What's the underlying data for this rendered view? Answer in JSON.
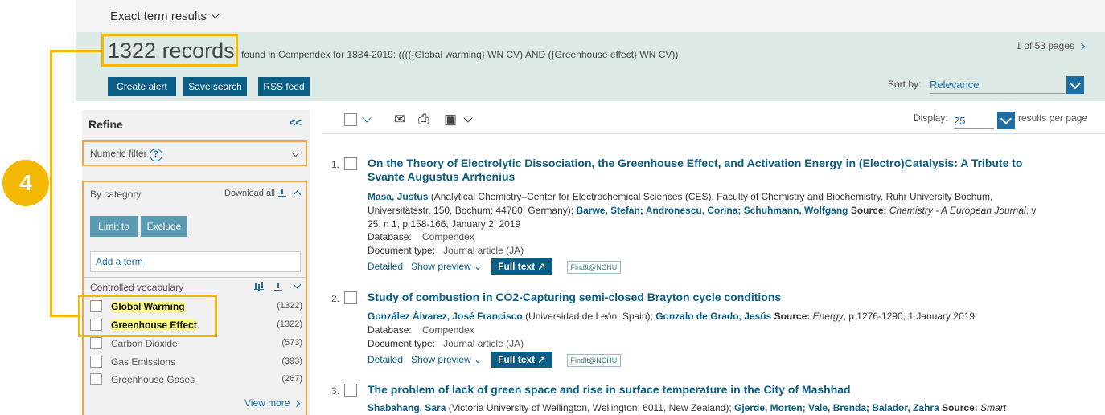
{
  "header": {
    "exact_term": "Exact term results",
    "records": "1322 records",
    "found_text": "found in Compendex for 1884-2019: (((({Global warming} WN CV) AND ({Greenhouse effect} WN CV))",
    "pages": "1 of 53 pages",
    "buttons": [
      "Create alert",
      "Save search",
      "RSS feed"
    ],
    "sort_label": "Sort by:",
    "sort_value": "Relevance"
  },
  "sidebar": {
    "refine": "Refine",
    "collapse": "<<",
    "numeric_filter": "Numeric filter",
    "help": "?",
    "by_category": "By category",
    "download_all": "Download all",
    "limit_to": "Limit to",
    "exclude": "Exclude",
    "add_term_placeholder": "Add a term",
    "controlled_vocab": "Controlled vocabulary",
    "items": [
      {
        "name": "Global Warming",
        "count": "(1322)"
      },
      {
        "name": "Greenhouse Effect",
        "count": "(1322)"
      },
      {
        "name": "Carbon Dioxide",
        "count": "(573)"
      },
      {
        "name": "Gas Emissions",
        "count": "(393)"
      },
      {
        "name": "Greenhouse Gases",
        "count": "(267)"
      }
    ],
    "view_more": "View more"
  },
  "annotation": {
    "step": "4",
    "color": "#f5b800"
  },
  "toolbar": {
    "display_label": "Display:",
    "display_value": "25",
    "per_page": "results per page"
  },
  "results": [
    {
      "num": "1.",
      "title": "On the Theory of Electrolytic Dissociation, the Greenhouse Effect, and Activation Energy in (Electro)Catalysis: A Tribute to Svante Augustus Arrhenius",
      "a1": "Masa, Justus",
      "aff1": " (Analytical Chemistry–Center for Electrochemical Sciences (CES), Faculty of Chemistry and Biochemistry, Ruhr University Bochum, Universitätsstr. 150, Bochum; 44780, Germany); ",
      "a2": "Barwe, Stefan; Andronescu, Corina; Schuhmann, Wolfgang",
      "source_label": " Source: ",
      "source": "Chemistry - A European Journal",
      "source_rest": ", v 25, n 1, p 158-166, January 2, 2019",
      "database": "Compendex",
      "doctype": "Journal article (JA)"
    },
    {
      "num": "2.",
      "title": "Study of combustion in CO2-Capturing semi-closed Brayton cycle conditions",
      "a1": "González Álvarez, José Francisco",
      "aff1": " (Universidad de León, Spain); ",
      "a2": "Gonzalo de Grado, Jesús",
      "source_label": " Source: ",
      "source": "Energy",
      "source_rest": ", p 1276-1290, 1 January 2019",
      "database": "Compendex",
      "doctype": "Journal article (JA)"
    },
    {
      "num": "3.",
      "title": "The problem of lack of green space and rise in surface temperature in the City of Mashhad",
      "a1": "Shabahang, Sara",
      "aff1": " (Victoria University of Wellington, Wellington; 6011, New Zealand); ",
      "a2": "Gjerde, Morten; Vale, Brenda; Balador, Zahra",
      "source_label": " Source: ",
      "source": "Smart",
      "source_rest": ""
    }
  ],
  "labels": {
    "database": "Database:",
    "doctype": "Document type:",
    "detailed": "Detailed",
    "show_preview": "Show preview",
    "full_text": "Full text",
    "findit": "FindIt@NCHU"
  }
}
